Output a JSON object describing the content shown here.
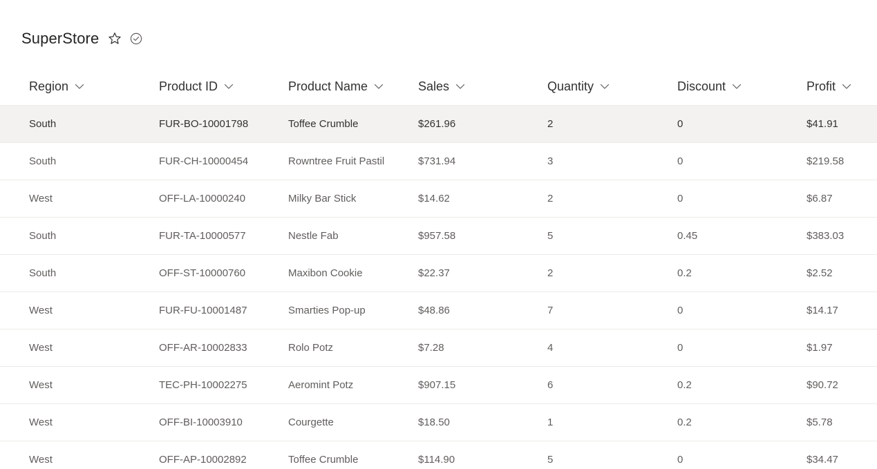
{
  "list": {
    "title": "SuperStore",
    "favorite_icon": "star-outline-icon",
    "status_icon": "circle-check-icon"
  },
  "colors": {
    "selected_row_background": "#f3f2f1",
    "row_divider": "#edebe9",
    "header_text": "#323130",
    "cell_text": "#605e5c"
  },
  "columns": [
    {
      "label": "Region",
      "icon": "chevron-down-icon"
    },
    {
      "label": "Product ID",
      "icon": "chevron-down-icon"
    },
    {
      "label": "Product Name",
      "icon": "chevron-down-icon"
    },
    {
      "label": "Sales",
      "icon": "chevron-down-icon"
    },
    {
      "label": "Quantity",
      "icon": "chevron-down-icon"
    },
    {
      "label": "Discount",
      "icon": "chevron-down-icon"
    },
    {
      "label": "Profit",
      "icon": "chevron-down-icon"
    }
  ],
  "rows": [
    {
      "selected": true,
      "cells": [
        "South",
        "FUR-BO-10001798",
        "Toffee Crumble",
        "$261.96",
        "2",
        "0",
        "$41.91"
      ]
    },
    {
      "cells": [
        "South",
        "FUR-CH-10000454",
        "Rowntree Fruit Pastil",
        "$731.94",
        "3",
        "0",
        "$219.58"
      ]
    },
    {
      "cells": [
        "West",
        "OFF-LA-10000240",
        "Milky Bar Stick",
        "$14.62",
        "2",
        "0",
        "$6.87"
      ]
    },
    {
      "cells": [
        "South",
        "FUR-TA-10000577",
        "Nestle Fab",
        "$957.58",
        "5",
        "0.45",
        "$383.03"
      ]
    },
    {
      "cells": [
        "South",
        "OFF-ST-10000760",
        "Maxibon Cookie",
        "$22.37",
        "2",
        "0.2",
        "$2.52"
      ]
    },
    {
      "cells": [
        "West",
        "FUR-FU-10001487",
        "Smarties Pop-up",
        "$48.86",
        "7",
        "0",
        "$14.17"
      ]
    },
    {
      "cells": [
        "West",
        "OFF-AR-10002833",
        "Rolo Potz",
        "$7.28",
        "4",
        "0",
        "$1.97"
      ]
    },
    {
      "cells": [
        "West",
        "TEC-PH-10002275",
        "Aeromint Potz",
        "$907.15",
        "6",
        "0.2",
        "$90.72"
      ]
    },
    {
      "cells": [
        "West",
        "OFF-BI-10003910",
        "Courgette",
        "$18.50",
        "1",
        "0.2",
        "$5.78"
      ]
    },
    {
      "cells": [
        "West",
        "OFF-AP-10002892",
        "Toffee Crumble",
        "$114.90",
        "5",
        "0",
        "$34.47"
      ]
    }
  ]
}
